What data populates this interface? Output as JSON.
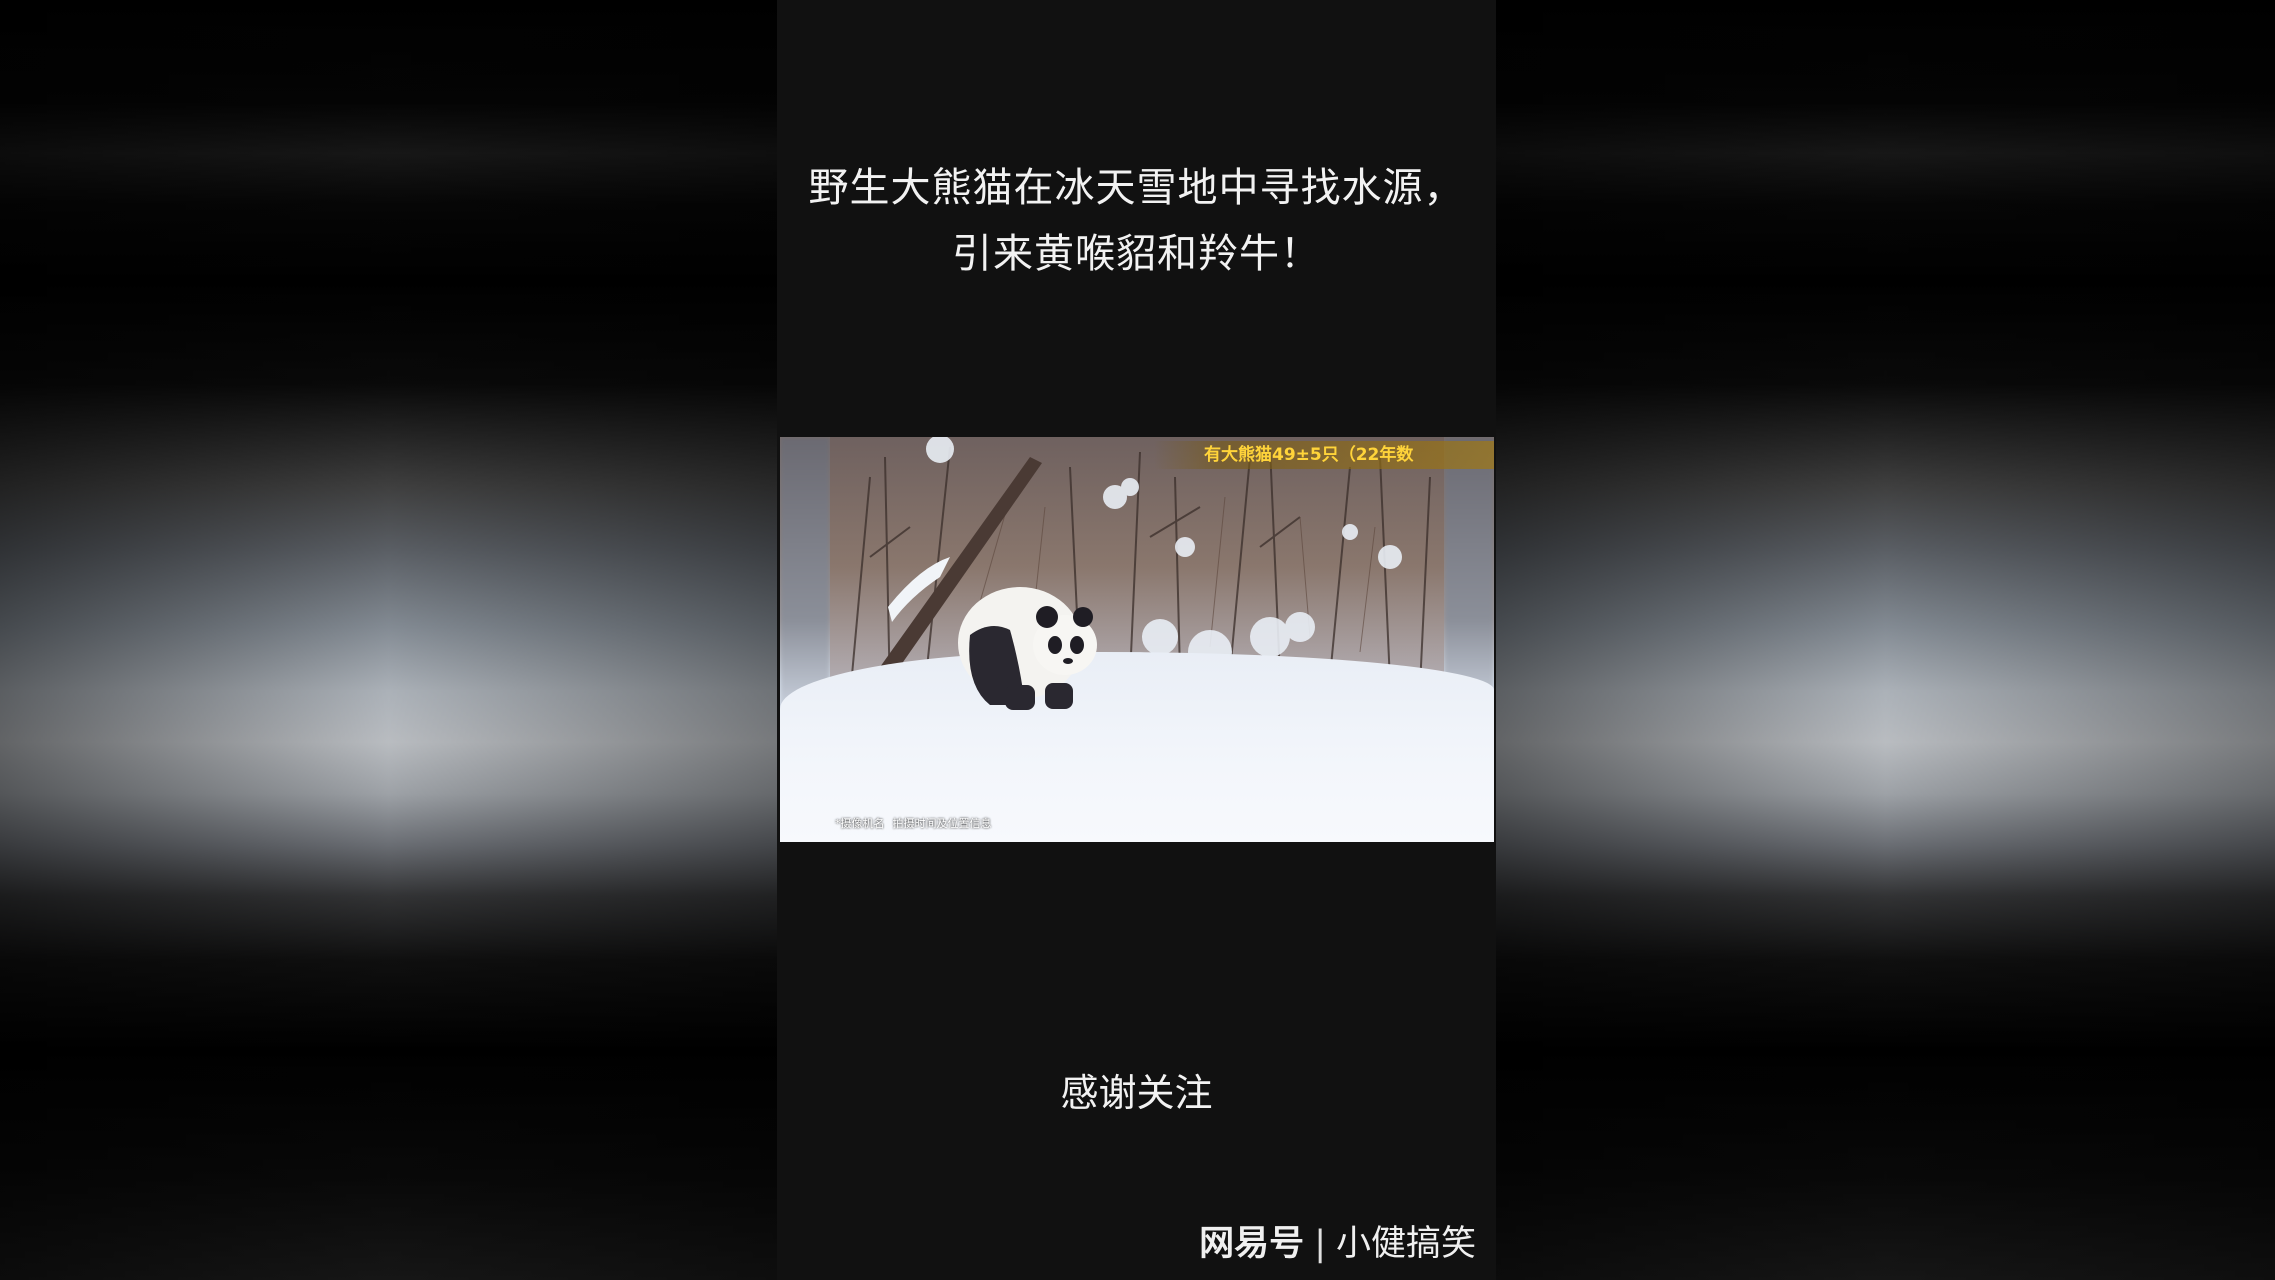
{
  "video_title": "野生大熊猫在冰天雪地中寻找水源，引来黄喉貂和羚牛！",
  "clip": {
    "banner_text": "有大熊猫49±5只（22年数",
    "camera_info": [
      "*摄像机名",
      "拍摄时间及位置信息"
    ]
  },
  "closing_caption": "感谢关注",
  "watermark": {
    "brand": "网易号",
    "separator": "|",
    "channel": "小健搞笑"
  },
  "colors": {
    "background": "#000000",
    "column": "#111111",
    "text": "#f2f2f2",
    "banner_text": "#ffd43a"
  }
}
